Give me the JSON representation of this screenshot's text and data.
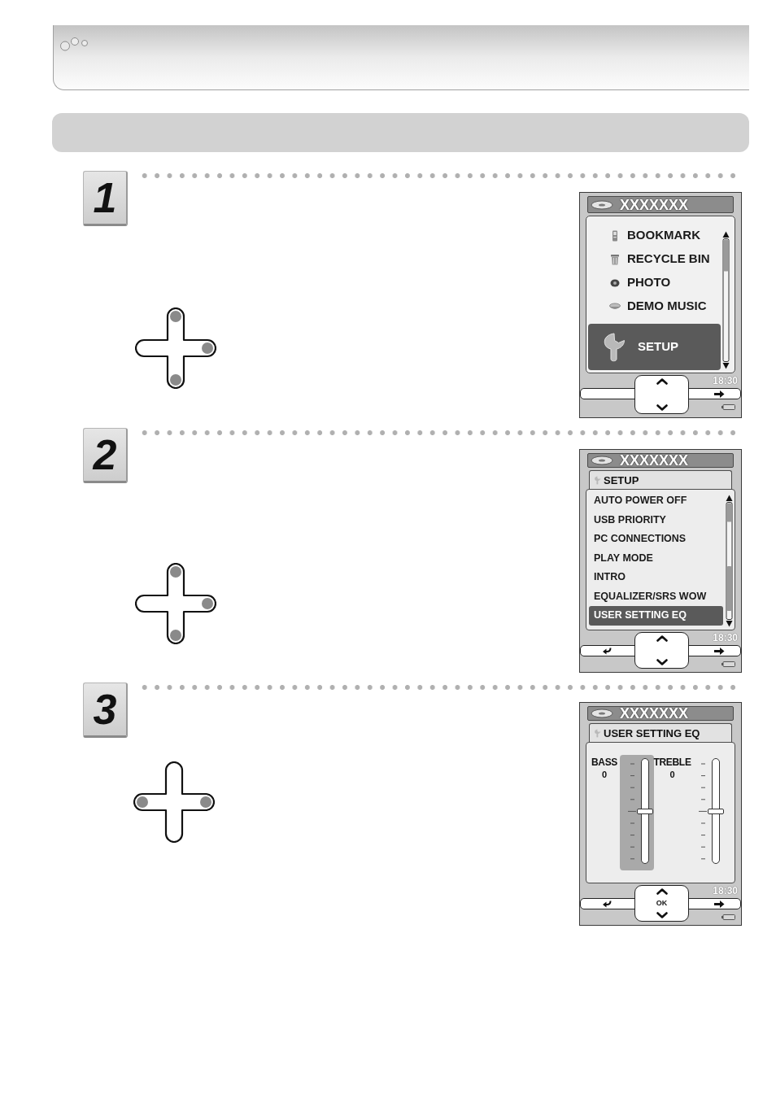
{
  "steps": [
    {
      "number": "1",
      "dpad": {
        "up": true,
        "right": true,
        "down": true,
        "left": false
      },
      "screen": {
        "kind": "menu",
        "title": "XXXXXXX",
        "items": [
          {
            "label": "BOOKMARK",
            "selected": false
          },
          {
            "label": "RECYCLE BIN",
            "selected": false
          },
          {
            "label": "PHOTO",
            "selected": false
          },
          {
            "label": "DEMO MUSIC",
            "selected": false
          },
          {
            "label": "SETUP",
            "selected": true
          }
        ],
        "clock": "18:30",
        "back": false
      }
    },
    {
      "number": "2",
      "dpad": {
        "up": true,
        "right": true,
        "down": true,
        "left": false
      },
      "screen": {
        "kind": "list",
        "title": "XXXXXXX",
        "header": "SETUP",
        "items": [
          {
            "label": "AUTO POWER OFF",
            "selected": false
          },
          {
            "label": "USB PRIORITY",
            "selected": false
          },
          {
            "label": "PC CONNECTIONS",
            "selected": false
          },
          {
            "label": "PLAY MODE",
            "selected": false
          },
          {
            "label": "INTRO",
            "selected": false
          },
          {
            "label": "EQUALIZER/SRS WOW",
            "selected": false
          },
          {
            "label": "USER SETTING EQ",
            "selected": true
          }
        ],
        "clock": "18:30",
        "back": true
      }
    },
    {
      "number": "3",
      "dpad": {
        "up": false,
        "right": true,
        "down": false,
        "left": true
      },
      "screen": {
        "kind": "eq",
        "title": "XXXXXXX",
        "header": "USER SETTING EQ",
        "sliders": [
          {
            "label": "BASS",
            "value": "0",
            "level": 0.5,
            "selected": true
          },
          {
            "label": "TREBLE",
            "value": "0",
            "level": 0.5,
            "selected": false
          }
        ],
        "clock": "18:30",
        "back": true,
        "center_label": "OK"
      }
    }
  ]
}
